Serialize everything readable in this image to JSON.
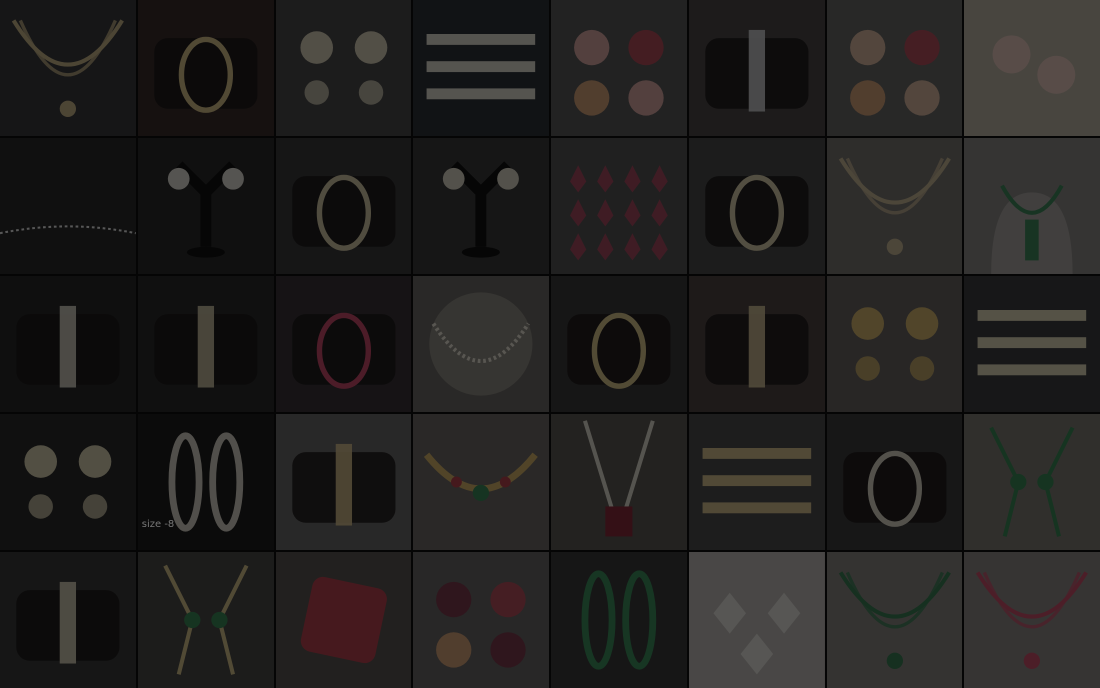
{
  "gallery": {
    "overlay_color": "#000000",
    "tiles": [
      {
        "subject": "necklace",
        "bg": "#3b3b3d",
        "accent": "#c9b58a",
        "caption": ""
      },
      {
        "subject": "bangle-on-pillow",
        "bg": "#3a2d2a",
        "accent": "#d6c089",
        "caption": ""
      },
      {
        "subject": "earrings",
        "bg": "#4a4a4a",
        "accent": "#d8cfb8",
        "caption": ""
      },
      {
        "subject": "bracelets",
        "bg": "#2f3338",
        "accent": "#e0dccf",
        "caption": ""
      },
      {
        "subject": "rings",
        "bg": "#5a5959",
        "accent": "#d9a9a4",
        "caption": ""
      },
      {
        "subject": "bracelet-pillow",
        "bg": "#4d4747",
        "accent": "#d0d0d4",
        "caption": ""
      },
      {
        "subject": "rings",
        "bg": "#6b6968",
        "accent": "#d9b9a0",
        "caption": ""
      },
      {
        "subject": "floral-earrings",
        "bg": "#bdb6a6",
        "accent": "#e6c7bd",
        "caption": ""
      },
      {
        "subject": "chain",
        "bg": "#2a2a2a",
        "accent": "#e5e5e5",
        "caption": ""
      },
      {
        "subject": "earrings-stand",
        "bg": "#2c2c2c",
        "accent": "#e0ddd4",
        "caption": ""
      },
      {
        "subject": "bangles-pillow",
        "bg": "#3a3a3c",
        "accent": "#d3c7a5",
        "caption": ""
      },
      {
        "subject": "earrings-stand",
        "bg": "#3a3a3a",
        "accent": "#d9d4c4",
        "caption": ""
      },
      {
        "subject": "pendants",
        "bg": "#555",
        "accent": "#b44a63",
        "caption": ""
      },
      {
        "subject": "bangle-pillow",
        "bg": "#4a4a4a",
        "accent": "#d8cdaa",
        "caption": ""
      },
      {
        "subject": "necklace-set",
        "bg": "#7a7672",
        "accent": "#c7b796",
        "caption": ""
      },
      {
        "subject": "necklace-bust",
        "bg": "#8c8986",
        "accent": "#3f8a5e",
        "caption": ""
      },
      {
        "subject": "bracelet-pillow",
        "bg": "#282828",
        "accent": "#d9d5c8",
        "caption": ""
      },
      {
        "subject": "bracelet-pillow",
        "bg": "#2c2c2c",
        "accent": "#d0c7a8",
        "caption": ""
      },
      {
        "subject": "bangle-pillow",
        "bg": "#3a3438",
        "accent": "#c94a6a",
        "caption": ""
      },
      {
        "subject": "pearl-necklace",
        "bg": "#6d6a66",
        "accent": "#e6e1d5",
        "caption": ""
      },
      {
        "subject": "bangle-pillow",
        "bg": "#3c3c3c",
        "accent": "#d8c58c",
        "caption": ""
      },
      {
        "subject": "bracelet-pillow",
        "bg": "#4f4443",
        "accent": "#d6c49a",
        "caption": ""
      },
      {
        "subject": "large-earrings",
        "bg": "#6a6562",
        "accent": "#d4b66e",
        "caption": ""
      },
      {
        "subject": "bracelet",
        "bg": "#3e3e40",
        "accent": "#e0d7b8",
        "caption": ""
      },
      {
        "subject": "earrings",
        "bg": "#2a2a2a",
        "accent": "#d8d0b0",
        "caption": ""
      },
      {
        "subject": "bangles",
        "bg": "#1f1f1f",
        "accent": "#d6d0c4",
        "caption": "size -8"
      },
      {
        "subject": "bracelet-pillow",
        "bg": "#6a6a6a",
        "accent": "#d9c28f",
        "caption": ""
      },
      {
        "subject": "choker",
        "bg": "#6e6b66",
        "accent": "#d5b46a",
        "caption": ""
      },
      {
        "subject": "long-necklace",
        "bg": "#5e5a55",
        "accent": "#e0dccf",
        "caption": ""
      },
      {
        "subject": "bracelet",
        "bg": "#4c4c4c",
        "accent": "#d4c08f",
        "caption": ""
      },
      {
        "subject": "bangle-pillow",
        "bg": "#3d3d3d",
        "accent": "#d9d4c6",
        "caption": ""
      },
      {
        "subject": "hand-chain",
        "bg": "#7f7b75",
        "accent": "#3c8a58",
        "caption": ""
      },
      {
        "subject": "bracelet-pillow",
        "bg": "#3a3a3a",
        "accent": "#ded6bf",
        "caption": ""
      },
      {
        "subject": "hand-chain",
        "bg": "#4b4a48",
        "accent": "#d6c28c",
        "caption": ""
      },
      {
        "subject": "ring",
        "bg": "#5a5651",
        "accent": "#b8424f",
        "caption": ""
      },
      {
        "subject": "rings",
        "bg": "#6a6866",
        "accent": "#7b3a4c",
        "caption": ""
      },
      {
        "subject": "bangles",
        "bg": "#3b3b3b",
        "accent": "#3e8f5e",
        "caption": ""
      },
      {
        "subject": "pendant-set",
        "bg": "#a5a19a",
        "accent": "#e4e2de",
        "caption": ""
      },
      {
        "subject": "necklace-set",
        "bg": "#8a8682",
        "accent": "#3b7f56",
        "caption": ""
      },
      {
        "subject": "necklace",
        "bg": "#8e8a86",
        "accent": "#c9506b",
        "caption": ""
      }
    ]
  }
}
